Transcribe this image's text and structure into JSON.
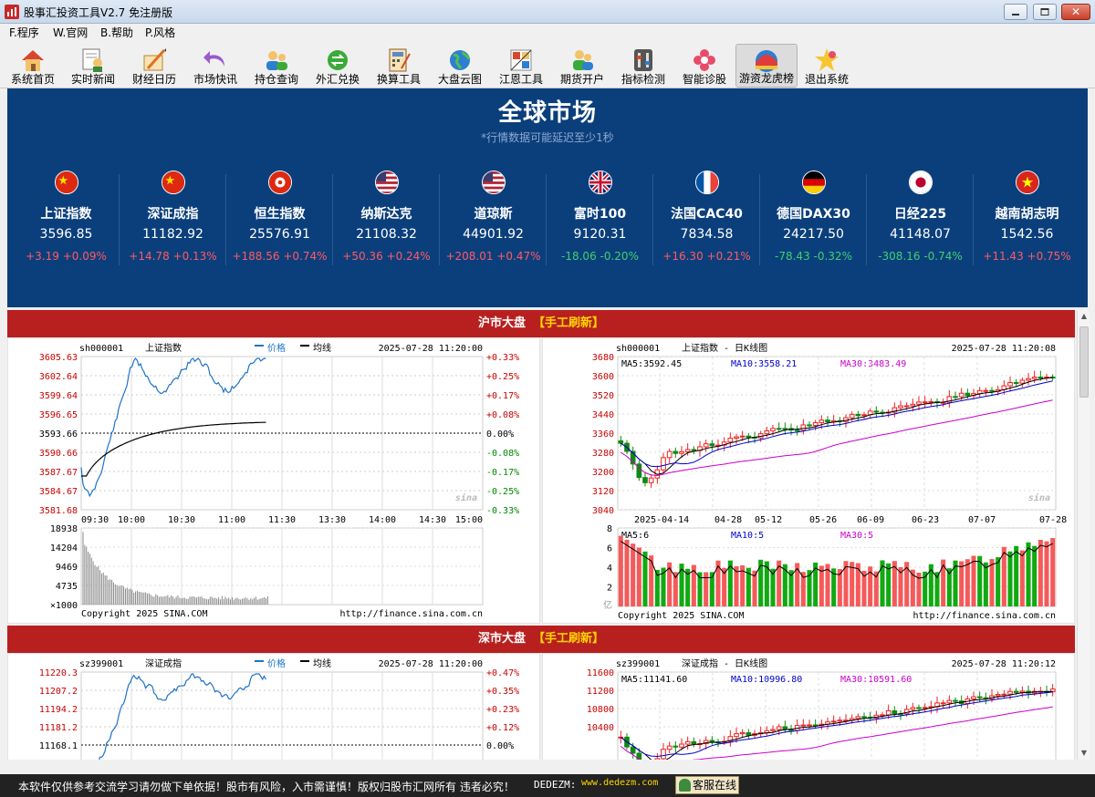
{
  "window": {
    "title": "股事汇投资工具V2.7 免注册版",
    "menu": [
      "F.程序",
      "W.官网",
      "B.帮助",
      "P.风格"
    ]
  },
  "toolbar": [
    {
      "label": "系统首页",
      "icon": "house-icon"
    },
    {
      "label": "实时新闻",
      "icon": "newsreader-icon"
    },
    {
      "label": "财经日历",
      "icon": "calendar-pencil-icon"
    },
    {
      "label": "市场快讯",
      "icon": "purple-arrow-icon"
    },
    {
      "label": "持仓查询",
      "icon": "users-icon"
    },
    {
      "label": "外汇兑换",
      "icon": "exchange-icon"
    },
    {
      "label": "换算工具",
      "icon": "calculator-icon"
    },
    {
      "label": "大盘云图",
      "icon": "globe-icon"
    },
    {
      "label": "江恩工具",
      "icon": "gann-tool-icon"
    },
    {
      "label": "期货开户",
      "icon": "account-users-icon"
    },
    {
      "label": "指标检测",
      "icon": "indicator-check-icon"
    },
    {
      "label": "智能诊股",
      "icon": "flower-icon"
    },
    {
      "label": "游资龙虎榜",
      "icon": "dragon-tiger-icon"
    },
    {
      "label": "退出系统",
      "icon": "star-exit-icon"
    }
  ],
  "global": {
    "title": "全球市场",
    "subtitle": "*行情数据可能延迟至少1秒",
    "markets": [
      {
        "name": "上证指数",
        "value": "3596.85",
        "change": "+3.19 +0.09%",
        "direction": "up",
        "flag": "cn"
      },
      {
        "name": "深证成指",
        "value": "11182.92",
        "change": "+14.78 +0.13%",
        "direction": "up",
        "flag": "cn"
      },
      {
        "name": "恒生指数",
        "value": "25576.91",
        "change": "+188.56 +0.74%",
        "direction": "up",
        "flag": "hk"
      },
      {
        "name": "纳斯达克",
        "value": "21108.32",
        "change": "+50.36 +0.24%",
        "direction": "up",
        "flag": "us"
      },
      {
        "name": "道琼斯",
        "value": "44901.92",
        "change": "+208.01 +0.47%",
        "direction": "up",
        "flag": "us"
      },
      {
        "name": "富时100",
        "value": "9120.31",
        "change": "-18.06 -0.20%",
        "direction": "down",
        "flag": "uk"
      },
      {
        "name": "法国CAC40",
        "value": "7834.58",
        "change": "+16.30 +0.21%",
        "direction": "up",
        "flag": "fr"
      },
      {
        "name": "德国DAX30",
        "value": "24217.50",
        "change": "-78.43 -0.32%",
        "direction": "down",
        "flag": "de"
      },
      {
        "name": "日经225",
        "value": "41148.07",
        "change": "-308.16 -0.74%",
        "direction": "down",
        "flag": "jp"
      },
      {
        "name": "越南胡志明",
        "value": "1542.56",
        "change": "+11.43 +0.75%",
        "direction": "up",
        "flag": "vn"
      }
    ]
  },
  "panels": {
    "refresh": "【手工刷新】",
    "sh_title": "沪市大盘",
    "sz_title": "深市大盘",
    "sh_intraday": {
      "code": "sh000001",
      "name": "上证指数",
      "legend_price": "价格",
      "legend_avg": "均线",
      "time": "2025-07-28 11:20:00",
      "price_ticks": [
        "3605.63",
        "3602.64",
        "3599.64",
        "3596.65",
        "3593.66",
        "3590.66",
        "3587.67",
        "3584.67",
        "3581.68"
      ],
      "pct_ticks": [
        "+0.33%",
        "+0.25%",
        "+0.17%",
        "+0.08%",
        "0.00%",
        "-0.08%",
        "-0.17%",
        "-0.25%",
        "-0.33%"
      ],
      "time_ticks": [
        "09:30",
        "10:00",
        "10:30",
        "11:00",
        "11:30",
        "13:30",
        "14:00",
        "14:30",
        "15:00"
      ],
      "vol_ticks": [
        "18938",
        "14204",
        "9469",
        "4735"
      ],
      "vol_unit": "×1000",
      "copyright": "Copyright 2025 SINA.COM",
      "url": "http://finance.sina.com.cn",
      "watermark": "sina"
    },
    "sh_kline": {
      "code": "sh000001",
      "name": "上证指数 - 日K线图",
      "time": "2025-07-28 11:20:08",
      "ma5": "MA5:3592.45",
      "ma10": "MA10:3558.21",
      "ma30": "MA30:3483.49",
      "price_ticks": [
        "3680",
        "3600",
        "3520",
        "3440",
        "3360",
        "3280",
        "3200",
        "3120",
        "3040"
      ],
      "date_ticks": [
        "2025-04-14",
        "04-28",
        "05-12",
        "05-26",
        "06-09",
        "06-23",
        "07-07",
        "07-28"
      ],
      "vol_ma5": "MA5:6",
      "vol_ma10": "MA10:5",
      "vol_ma30": "MA30:5",
      "vol_ticks": [
        "8",
        "6",
        "4",
        "2"
      ],
      "vol_unit": "亿",
      "copyright": "Copyright 2025 SINA.COM",
      "url": "http://finance.sina.com.cn",
      "watermark": "sina"
    },
    "sz_intraday": {
      "code": "sz399001",
      "name": "深证成指",
      "legend_price": "价格",
      "legend_avg": "均线",
      "time": "2025-07-28 11:20:00",
      "price_ticks": [
        "11220.3",
        "11207.2",
        "11194.2",
        "11181.2",
        "11168.1"
      ],
      "pct_ticks": [
        "+0.47%",
        "+0.35%",
        "+0.23%",
        "+0.12%",
        "0.00%"
      ]
    },
    "sz_kline": {
      "code": "sz399001",
      "name": "深证成指 - 日K线图",
      "time": "2025-07-28 11:20:12",
      "ma5": "MA5:11141.60",
      "ma10": "MA10:10996.80",
      "ma30": "MA30:10591.60",
      "price_ticks": [
        "11600",
        "11200",
        "10800",
        "10400"
      ]
    }
  },
  "colors": {
    "banner": "#0b3f7c",
    "header_red": "#b82020",
    "up": "#ff5a64",
    "down": "#3fcf72",
    "price_line": "#1e73c8",
    "candle_up": "#ee2222",
    "candle_down": "#118811",
    "ma10": "#0000cc",
    "ma30": "#cc00cc"
  },
  "statusbar": {
    "disclaimer": "本软件仅供参考交流学习请勿做下单依据！股市有风险，入市需谨慎！版权归股市汇网所有 违者必究！",
    "site_label": "DEDEZM:",
    "site_url": "www.dedezm.com",
    "service": "客服在线"
  }
}
